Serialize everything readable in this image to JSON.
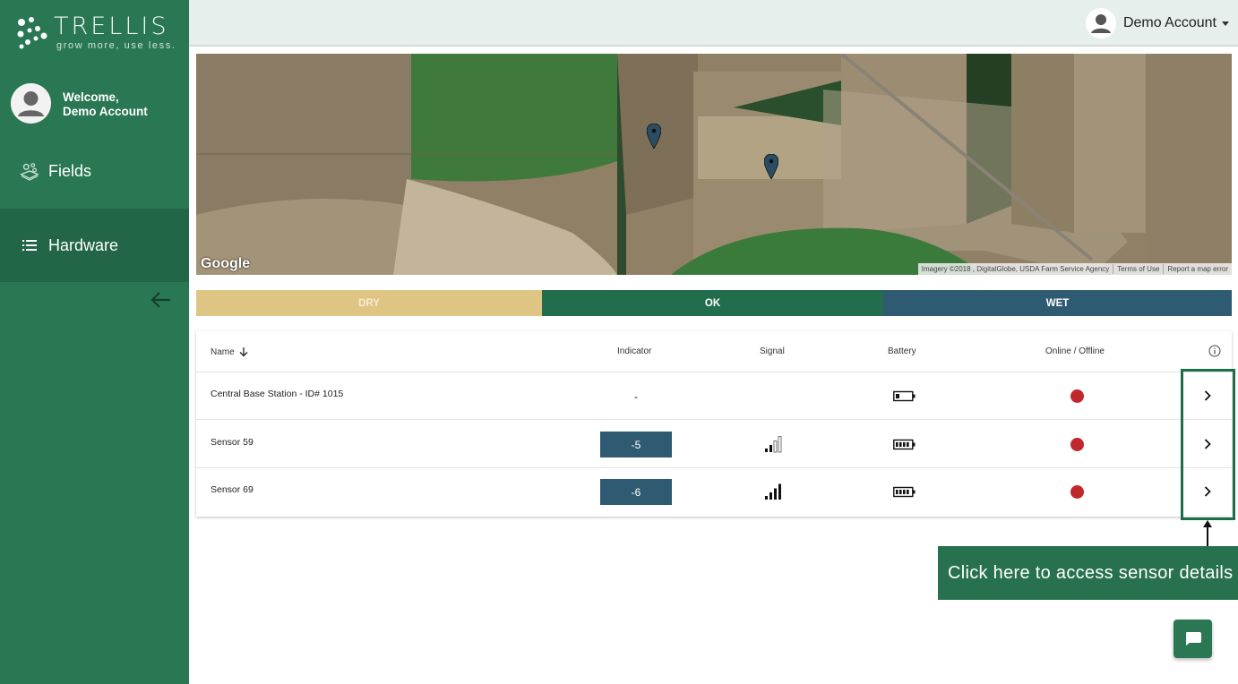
{
  "brand": {
    "name": "TRELLIS",
    "tagline": "grow more, use less."
  },
  "sidebar": {
    "welcome_line1": "Welcome,",
    "welcome_line2": "Demo Account",
    "items": [
      {
        "label": "Fields",
        "icon": "fields-icon"
      },
      {
        "label": "Hardware",
        "icon": "list-icon",
        "active": true
      }
    ],
    "collapse_icon": "arrow-left-icon"
  },
  "header": {
    "account_name": "Demo Account"
  },
  "map": {
    "provider_logo": "Google",
    "attribution": [
      "Imagery ©2018 , DigitalGlobe, USDA Farm Service Agency",
      "Terms of Use",
      "Report a map error"
    ],
    "marker_count": 2
  },
  "legend": {
    "dry": "DRY",
    "ok": "OK",
    "wet": "WET"
  },
  "table": {
    "headers": {
      "name": "Name",
      "indicator": "Indicator",
      "signal": "Signal",
      "battery": "Battery",
      "online": "Online / Offline"
    },
    "rows": [
      {
        "name": "Central Base Station - ID# 1015",
        "indicator": "-",
        "signal_bars": 0,
        "battery": "low",
        "status": "offline"
      },
      {
        "name": "Sensor 59",
        "indicator": "-5",
        "signal_bars": 2,
        "battery": "full",
        "status": "offline"
      },
      {
        "name": "Sensor 69",
        "indicator": "-6",
        "signal_bars": 4,
        "battery": "full",
        "status": "offline"
      }
    ]
  },
  "callout": {
    "text": "Click here to access sensor details"
  },
  "colors": {
    "sidebar": "#2a7753",
    "dry": "#dfc584",
    "ok": "#226e4c",
    "wet": "#2f5b72",
    "offline": "#c0282d"
  }
}
